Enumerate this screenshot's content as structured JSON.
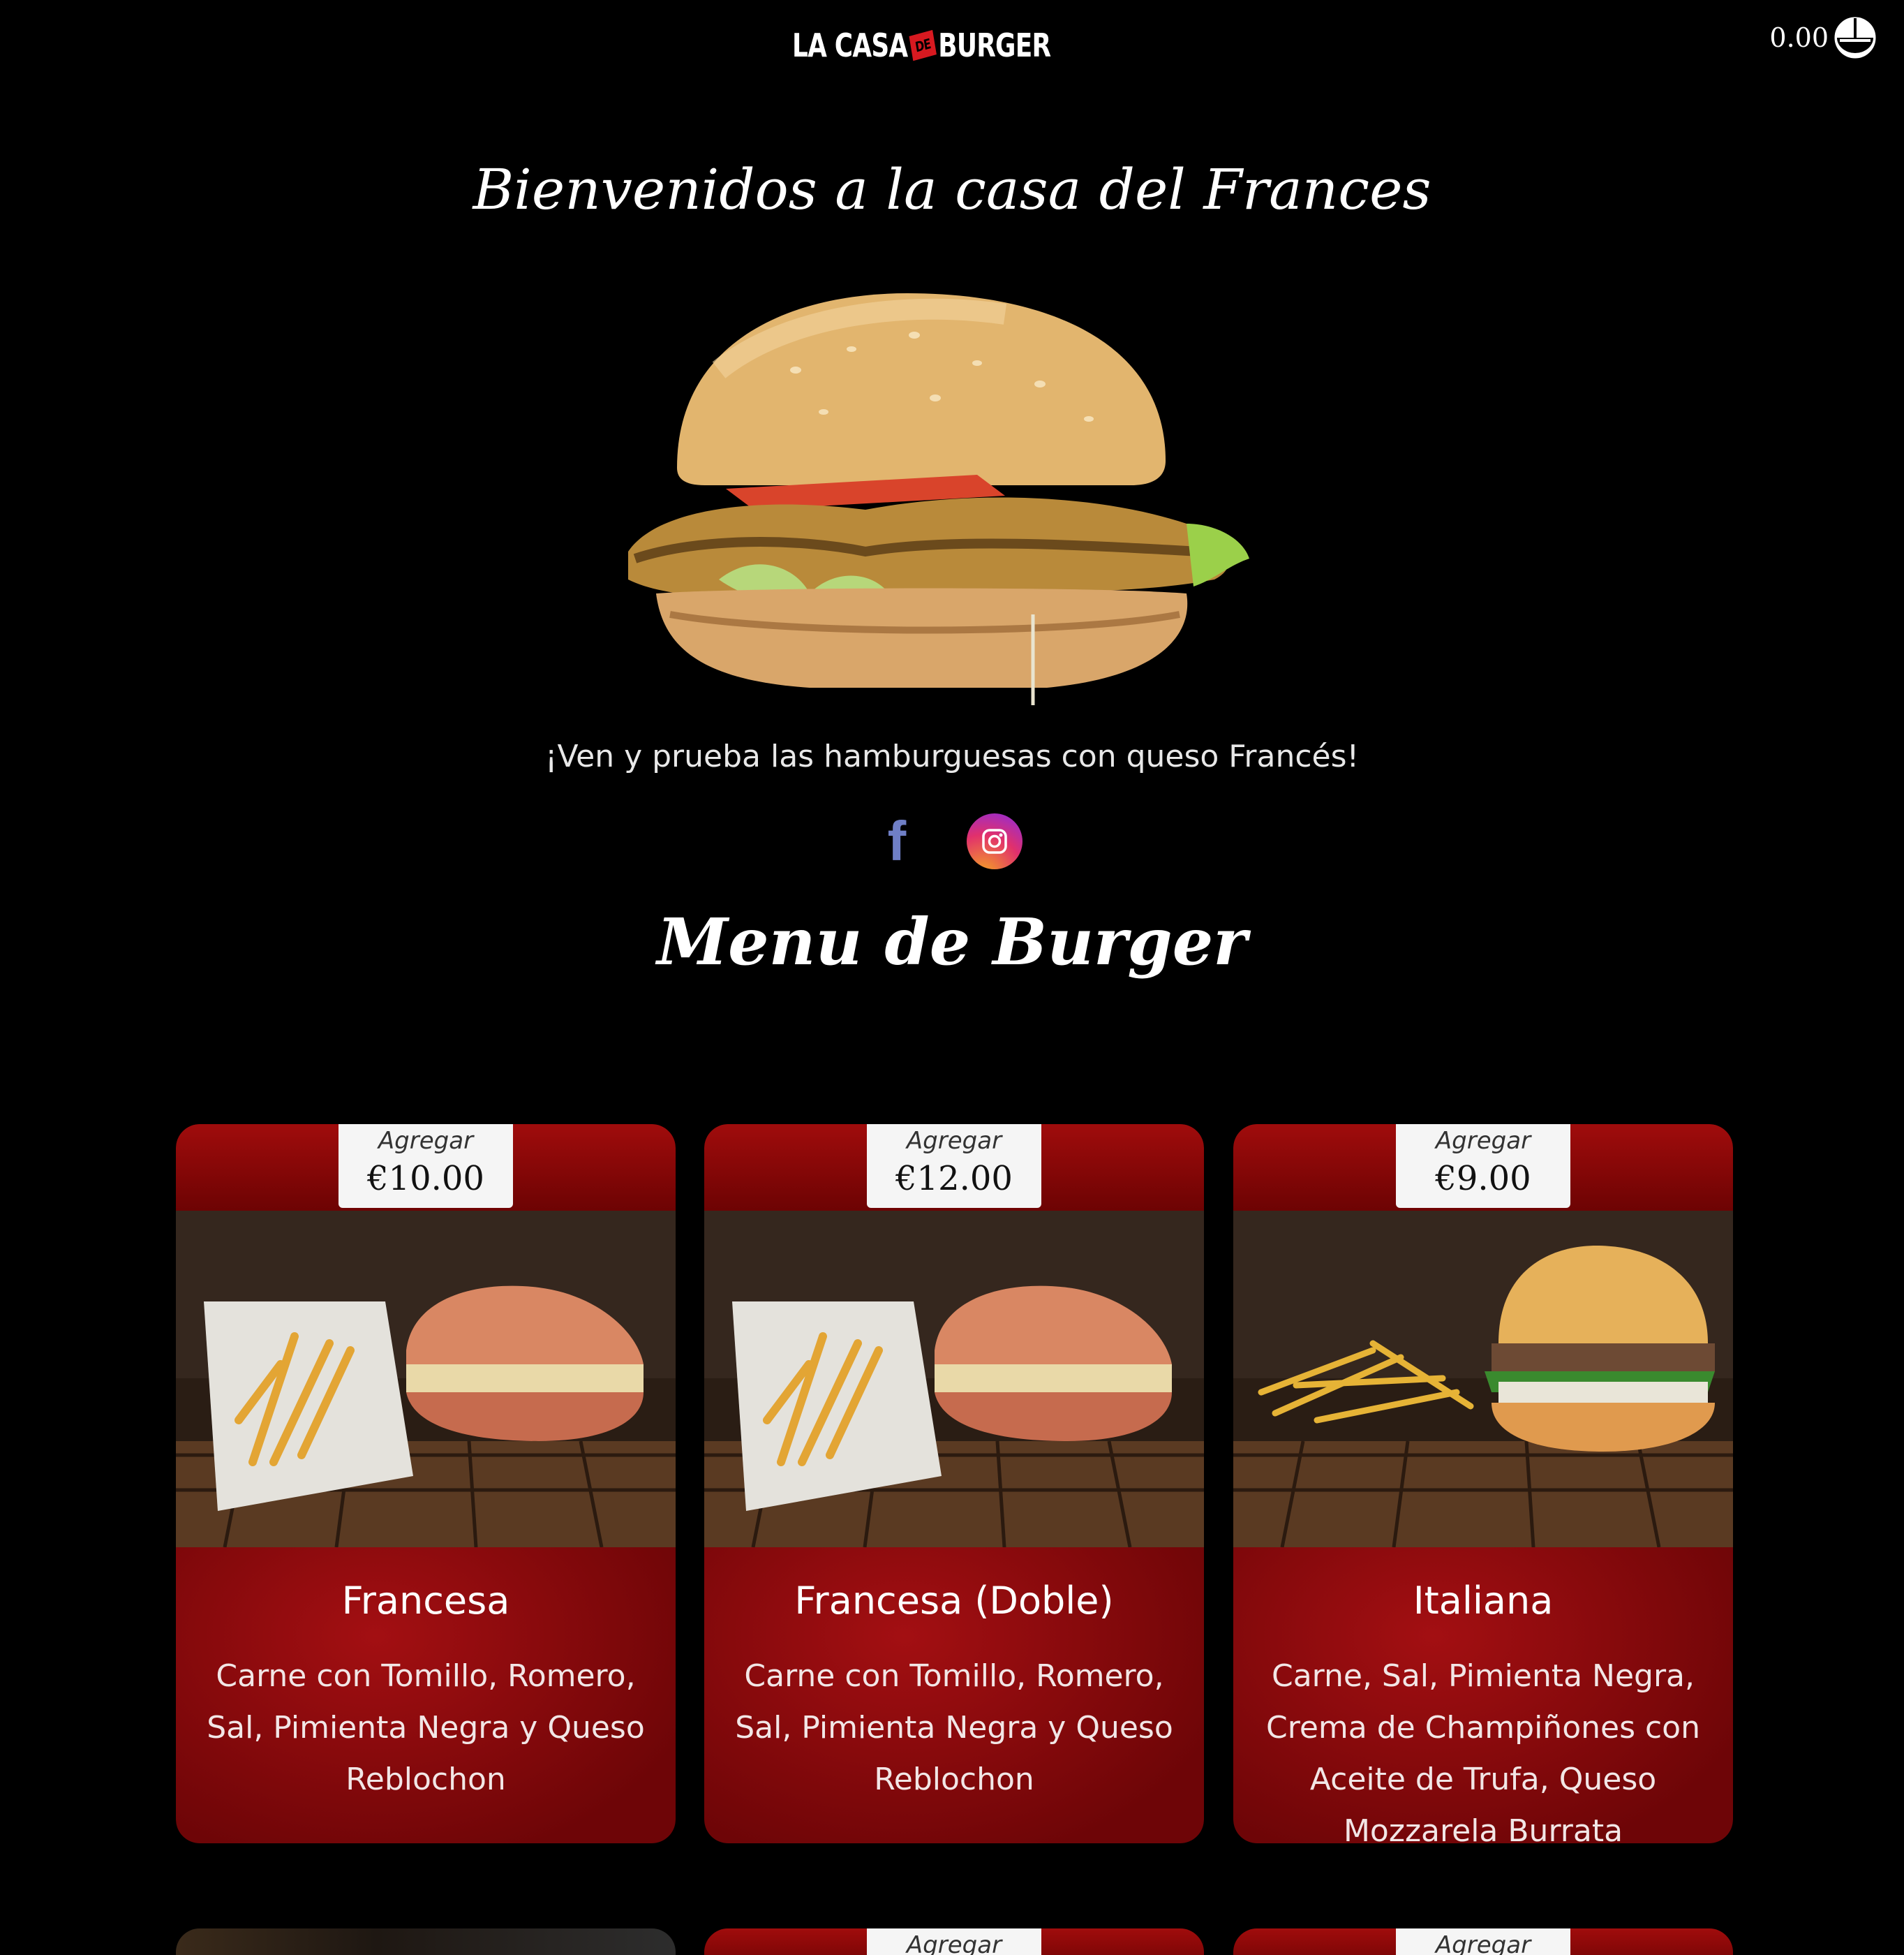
{
  "header": {
    "logo": {
      "part1": "LA CASA",
      "part2": "DE",
      "part3": "BURGER"
    },
    "cart_total": "0.00",
    "cart_icon": "cart-bowl-icon"
  },
  "hero": {
    "title": "Bienvenidos a la casa del Frances",
    "tagline": "¡Ven y prueba las hamburguesas con queso Francés!",
    "social": {
      "facebook_icon": "facebook-icon",
      "instagram_icon": "instagram-icon"
    }
  },
  "menu": {
    "title": "Menu de Burger",
    "items": [
      {
        "add_label": "Agregar",
        "price": "€10.00",
        "name": "Francesa",
        "description": "Carne con Tomillo, Romero, Sal, Pimienta Negra y Queso Reblochon"
      },
      {
        "add_label": "Agregar",
        "price": "€12.00",
        "name": "Francesa (Doble)",
        "description": "Carne con Tomillo, Romero, Sal, Pimienta Negra y Queso Reblochon"
      },
      {
        "add_label": "Agregar",
        "price": "€9.00",
        "name": "Italiana",
        "description": "Carne, Sal, Pimienta Negra, Crema de Champiñones con Aceite de Trufa, Queso Mozzarela Burrata"
      }
    ],
    "next_row": [
      {
        "add_label": ""
      },
      {
        "add_label": "Agregar"
      },
      {
        "add_label": "Agregar"
      }
    ]
  },
  "colors": {
    "background": "#000000",
    "card_red": "#8b0a0a",
    "price_box": "#f5f5f5",
    "facebook": "#6f7fc6"
  }
}
